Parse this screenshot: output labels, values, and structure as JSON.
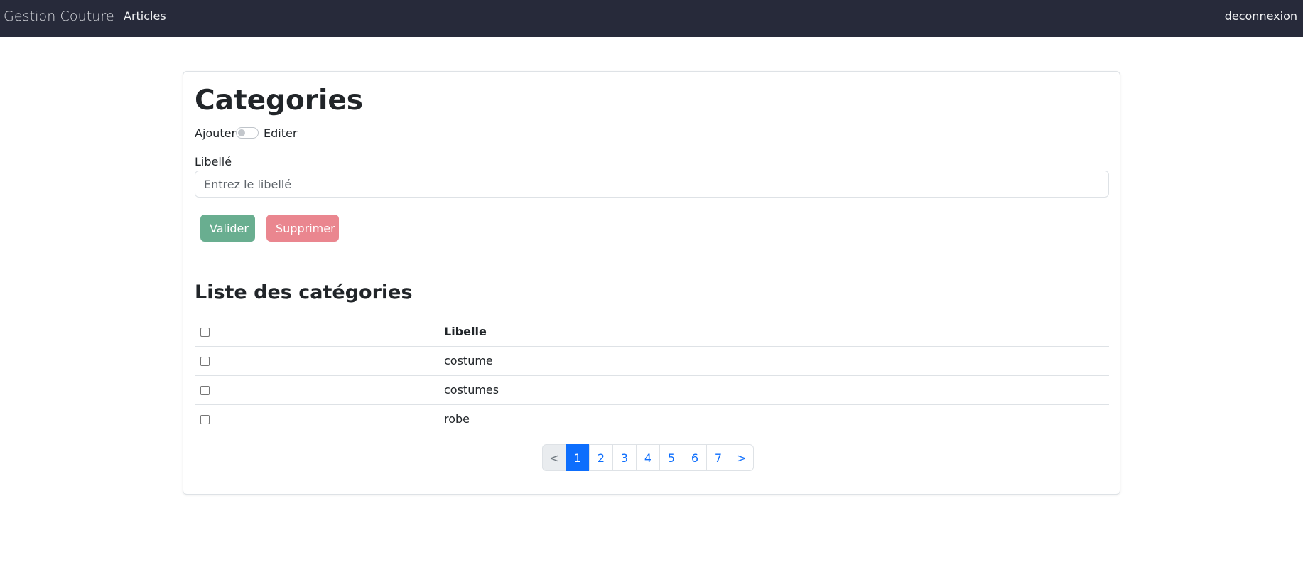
{
  "navbar": {
    "brand": "Gestion Couture",
    "links": [
      "Articles"
    ],
    "logout": "deconnexion",
    "background": "#272a3a"
  },
  "page": {
    "title": "Categories",
    "toggle": {
      "left_label": "Ajouter",
      "right_label": "Editer",
      "checked": false
    }
  },
  "form": {
    "label": "Libellé",
    "input": {
      "value": "",
      "placeholder": "Entrez le libellé"
    },
    "valider_label": "Valider",
    "supprimer_label": "Supprimer",
    "colors": {
      "valider": "#69ae90",
      "supprimer": "#ea868f"
    }
  },
  "list": {
    "title": "Liste des catégories",
    "columns": [
      "",
      "Libelle"
    ],
    "rows": [
      {
        "libelle": "costume",
        "checked": false
      },
      {
        "libelle": "costumes",
        "checked": false
      },
      {
        "libelle": "robe",
        "checked": false
      }
    ]
  },
  "pagination": {
    "prev": "<",
    "pages": [
      "1",
      "2",
      "3",
      "4",
      "5",
      "6",
      "7"
    ],
    "current": "1",
    "next": ">",
    "accent": "#0d6efd"
  }
}
